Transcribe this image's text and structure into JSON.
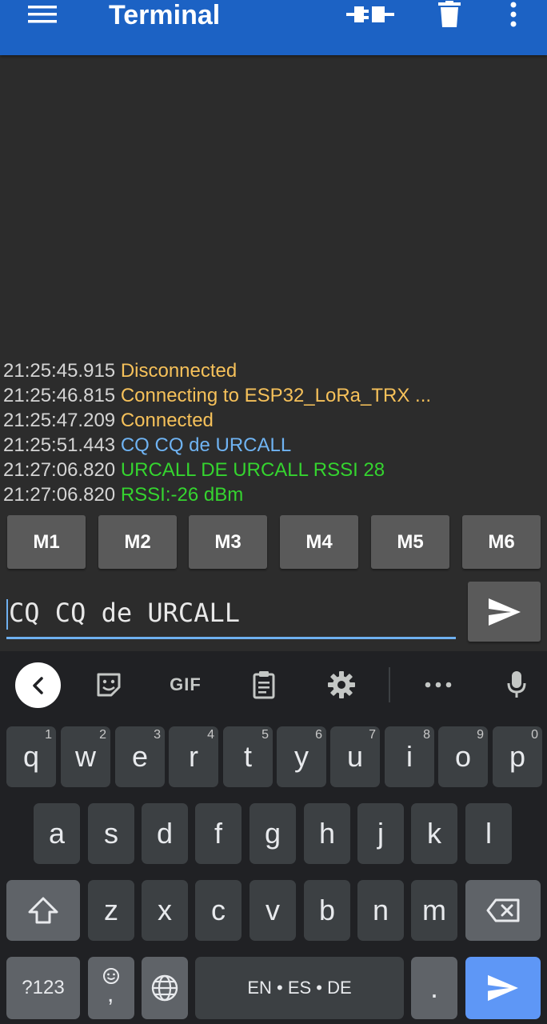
{
  "appbar": {
    "title": "Terminal",
    "menu_icon": "hamburger-menu-icon",
    "connect_icon": "plug-connect-icon",
    "clear_icon": "trash-icon",
    "overflow_icon": "more-vert-icon",
    "bg_color": "#1c62c4"
  },
  "terminal": {
    "lines": [
      {
        "time": "21:25:45.915",
        "text": "Disconnected",
        "color": "#f6c15a"
      },
      {
        "time": "21:25:46.815",
        "text": "Connecting to ESP32_LoRa_TRX ...",
        "color": "#f6c15a"
      },
      {
        "time": "21:25:47.209",
        "text": "Connected",
        "color": "#f6c15a"
      },
      {
        "time": "21:25:51.443",
        "text": "CQ CQ de URCALL",
        "color": "#6fb3f2"
      },
      {
        "time": "21:27:06.820",
        "text": "URCALL DE URCALL RSSI 28",
        "color": "#35d42f"
      },
      {
        "time": "21:27:06.820",
        "text": "RSSI:-26 dBm",
        "color": "#35d42f"
      }
    ]
  },
  "macros": [
    "M1",
    "M2",
    "M3",
    "M4",
    "M5",
    "M6"
  ],
  "input": {
    "value": "CQ CQ de URCALL",
    "send_icon": "send-icon"
  },
  "keyboard": {
    "toolbar": [
      "back-chevron-icon",
      "sticker-icon",
      "GIF",
      "clipboard-icon",
      "settings-gear-icon",
      "more-horiz-icon",
      "microphone-icon"
    ],
    "row1": [
      "q",
      "w",
      "e",
      "r",
      "t",
      "y",
      "u",
      "i",
      "o",
      "p"
    ],
    "row1_hints": [
      "1",
      "2",
      "3",
      "4",
      "5",
      "6",
      "7",
      "8",
      "9",
      "0"
    ],
    "row2": [
      "a",
      "s",
      "d",
      "f",
      "g",
      "h",
      "j",
      "k",
      "l"
    ],
    "row3": [
      "z",
      "x",
      "c",
      "v",
      "b",
      "n",
      "m"
    ],
    "symbols_label": "?123",
    "comma_label": ",",
    "period_label": ".",
    "space_label": "EN • ES • DE",
    "shift_icon": "shift-icon",
    "backspace_icon": "backspace-icon",
    "emoji_icon": "emoji-icon",
    "globe_icon": "globe-icon",
    "enter_icon": "send-icon"
  }
}
